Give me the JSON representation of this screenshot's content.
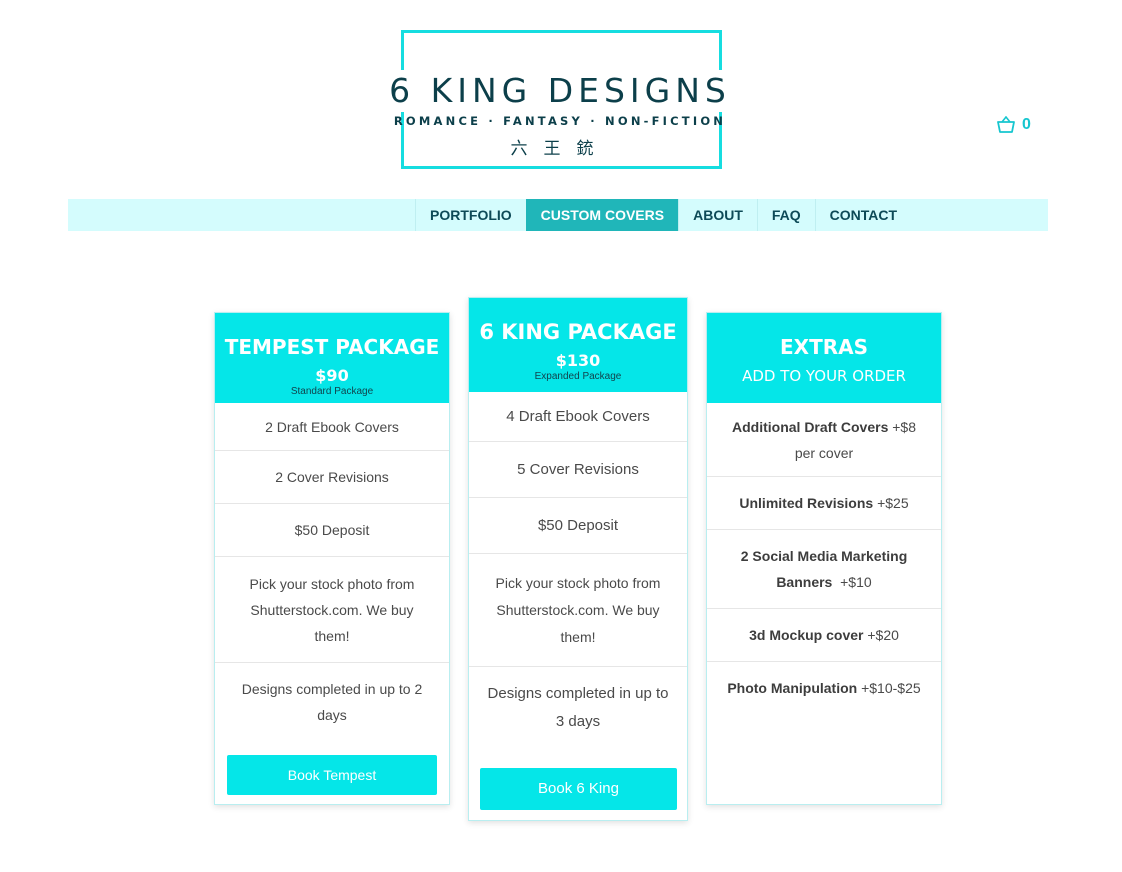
{
  "logo": {
    "title": "6 KING DESIGNS",
    "tagline": "ROMANCE · FANTASY · NON-FICTION",
    "cjk": "六王銃"
  },
  "cart": {
    "icon": "shopping-basket-icon",
    "count": "0"
  },
  "nav": {
    "items": [
      {
        "label": "PORTFOLIO"
      },
      {
        "label": "CUSTOM COVERS",
        "active": true
      },
      {
        "label": "ABOUT"
      },
      {
        "label": "FAQ"
      },
      {
        "label": "CONTACT"
      }
    ]
  },
  "colors": {
    "accent": "#05e6e8",
    "nav_bg": "#d4fcfd",
    "nav_active": "#20b6b9",
    "text_dark": "#0c3f4a"
  },
  "tempest": {
    "title": "TEMPEST PACKAGE",
    "price": "$90",
    "sub": "Standard Package",
    "features": [
      "2  Draft Ebook Covers",
      "2 Cover Revisions",
      "$50 Deposit",
      "Pick your stock photo from Shutterstock.com. We buy them!",
      "Designs completed in up to 2 days"
    ],
    "button": "Book Tempest"
  },
  "king": {
    "title": "6 KING PACKAGE",
    "price": "$130",
    "sub": "Expanded Package",
    "features": [
      "4 Draft Ebook Covers",
      "5 Cover Revisions",
      "$50 Deposit",
      "Pick your stock photo from Shutterstock.com. We buy them!",
      "Designs completed in up to 3 days"
    ],
    "button": "Book 6 King"
  },
  "extras": {
    "title": "EXTRAS",
    "subtitle": "ADD TO YOUR ORDER",
    "items": [
      {
        "name": "Additional Draft Covers",
        "price": " +$8 per cover"
      },
      {
        "name": "Unlimited Revisions",
        "price": " +$25"
      },
      {
        "name": "2 Social Media Marketing Banners",
        "price": "  +$10"
      },
      {
        "name": "3d Mockup cover",
        "price": " +$20"
      },
      {
        "name": "Photo Manipulation",
        "price": " +$10-$25"
      }
    ]
  }
}
